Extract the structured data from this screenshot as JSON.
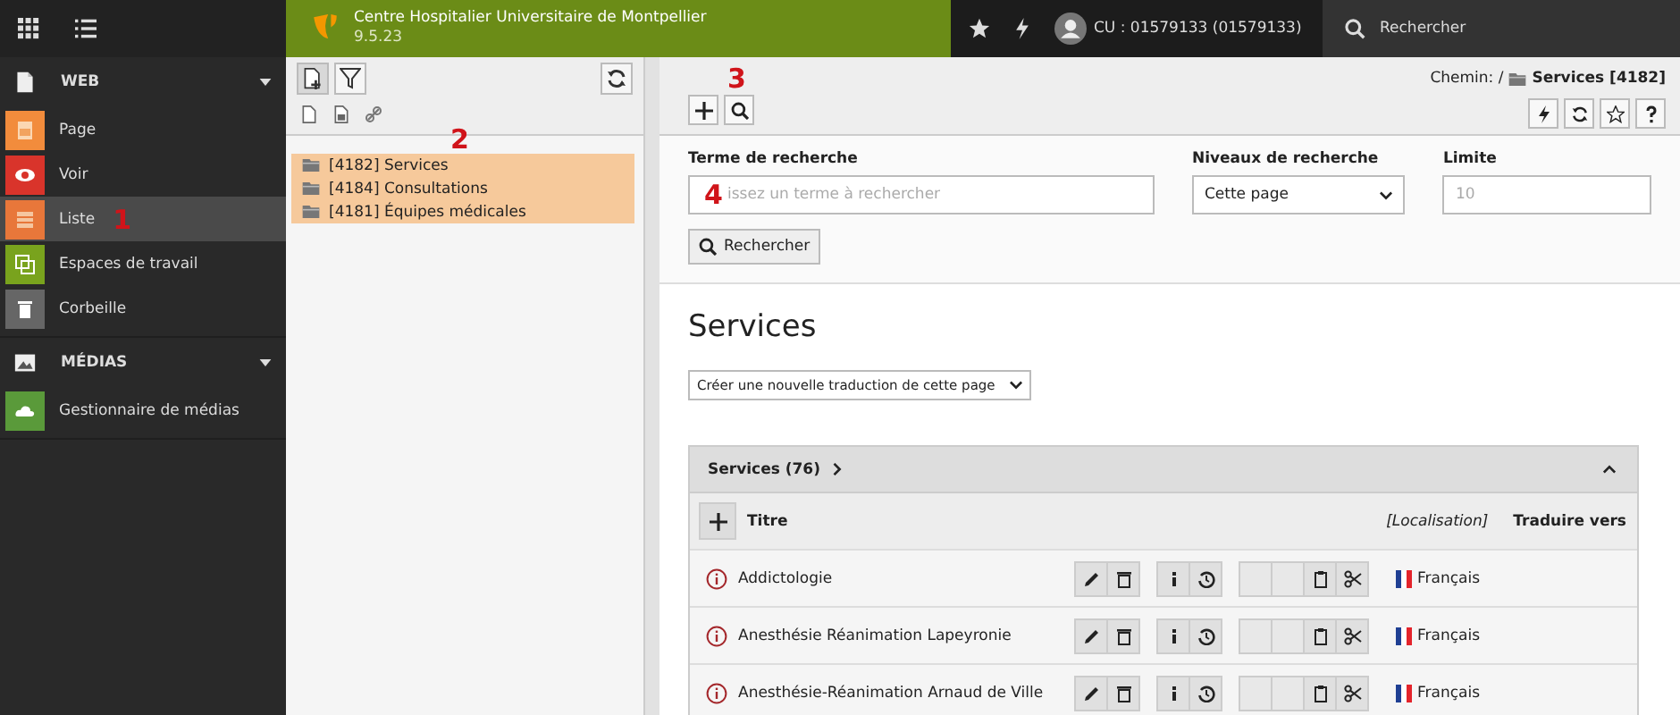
{
  "topbar": {
    "site_name": "Centre Hospitalier Universitaire de Montpellier",
    "version": "9.5.23",
    "user": "CU : 01579133 (01579133)",
    "search_label": "Rechercher"
  },
  "sidebar": {
    "groups": [
      {
        "title": "WEB",
        "kind": "web",
        "expanded": true,
        "items": [
          {
            "label": "Page",
            "kind": "page",
            "color": "#f28c3c",
            "selected": false
          },
          {
            "label": "Voir",
            "kind": "view",
            "color": "#d9342b",
            "selected": false
          },
          {
            "label": "Liste",
            "kind": "list",
            "color": "#e8773a",
            "selected": true,
            "annotation": "1"
          },
          {
            "label": "Espaces de travail",
            "kind": "workspace",
            "color": "#79a31d",
            "selected": false
          },
          {
            "label": "Corbeille",
            "kind": "trash",
            "color": "#666666",
            "selected": false
          }
        ]
      },
      {
        "title": "MÉDIAS",
        "kind": "media",
        "expanded": true,
        "items": [
          {
            "label": "Gestionnaire de médias",
            "kind": "cloud",
            "color": "#5a9a3a",
            "selected": false
          }
        ]
      }
    ]
  },
  "tree": {
    "annotation": "2",
    "items": [
      {
        "label": "[4182] Services",
        "highlighted": true
      },
      {
        "label": "[4184] Consultations",
        "highlighted": true
      },
      {
        "label": "[4181] Équipes médicales",
        "highlighted": true
      }
    ]
  },
  "docheader": {
    "search_annotation": "3",
    "path_label": "Chemin: /",
    "path_page": "Services [4182]"
  },
  "search_form": {
    "term_label": "Terme de recherche",
    "term_placeholder": "issez un terme à rechercher",
    "term_annotation": "4",
    "levels_label": "Niveaux de recherche",
    "levels_value": "Cette page",
    "limit_label": "Limite",
    "limit_placeholder": "10",
    "submit": "Rechercher"
  },
  "page_title": "Services",
  "translate_select": "Créer une nouvelle traduction de cette page",
  "table": {
    "title": "Services (76)",
    "expanded": true,
    "columns": [
      "Titre",
      "[Localisation]",
      "Traduire vers"
    ],
    "rows": [
      {
        "title": "Addictologie",
        "language": "Français"
      },
      {
        "title": "Anesthésie Réanimation Lapeyronie",
        "language": "Français"
      },
      {
        "title": "Anesthésie-Réanimation Arnaud de Ville",
        "language": "Français"
      }
    ]
  }
}
